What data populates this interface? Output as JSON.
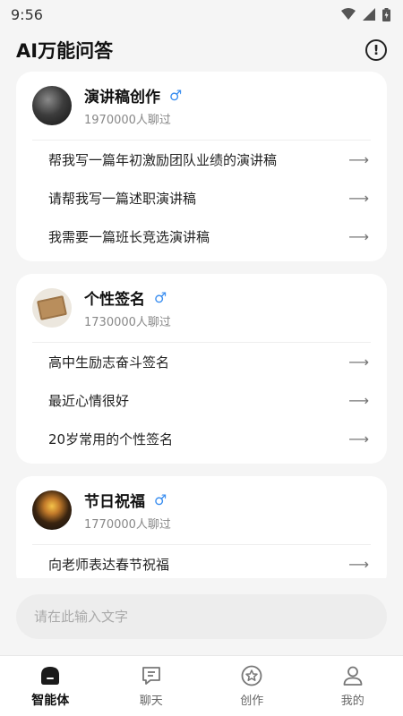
{
  "status": {
    "time": "9:56"
  },
  "header": {
    "title": "AI万能问答"
  },
  "cards": [
    {
      "title": "演讲稿创作",
      "subtitle": "1970000人聊过",
      "questions": [
        "帮我写一篇年初激励团队业绩的演讲稿",
        "请帮我写一篇述职演讲稿",
        "我需要一篇班长竞选演讲稿"
      ]
    },
    {
      "title": "个性签名",
      "subtitle": "1730000人聊过",
      "questions": [
        "高中生励志奋斗签名",
        "最近心情很好",
        "20岁常用的个性签名"
      ]
    },
    {
      "title": "节日祝福",
      "subtitle": "1770000人聊过",
      "questions": [
        "向老师表达春节祝福"
      ]
    }
  ],
  "input": {
    "placeholder": "请在此输入文字"
  },
  "tabs": [
    {
      "label": "智能体",
      "icon": "agent-icon",
      "active": true
    },
    {
      "label": "聊天",
      "icon": "chat-icon",
      "active": false
    },
    {
      "label": "创作",
      "icon": "create-icon",
      "active": false
    },
    {
      "label": "我的",
      "icon": "profile-icon",
      "active": false
    }
  ],
  "colors": {
    "accent": "#3a8ef0",
    "background": "#f5f5f5",
    "card": "#ffffff"
  }
}
